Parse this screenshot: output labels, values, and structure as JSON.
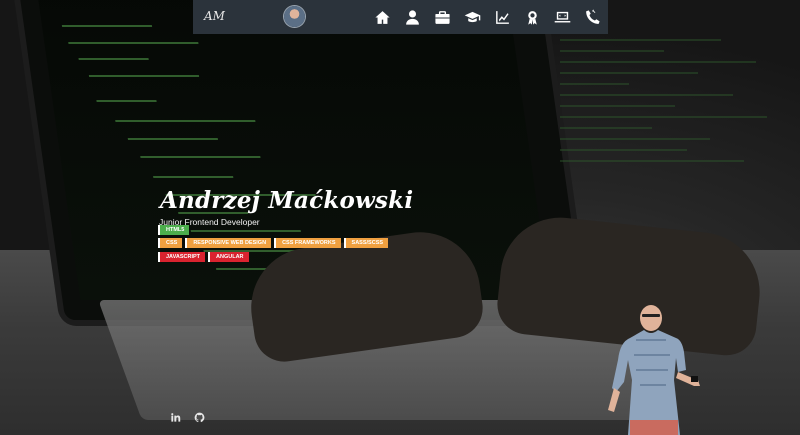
{
  "nav": {
    "logo": "AM",
    "icons": [
      "home-icon",
      "user-icon",
      "briefcase-icon",
      "graduation-cap-icon",
      "chart-line-icon",
      "certificate-icon",
      "laptop-code-icon",
      "phone-icon"
    ]
  },
  "hero": {
    "name": "Andrzej Maćkowski",
    "role": "Junior Frontend Developer"
  },
  "skills": {
    "row1": [
      {
        "label": "HTML5",
        "color": "#4cae4c"
      }
    ],
    "row2": [
      {
        "label": "CSS",
        "color": "#f0a040"
      },
      {
        "label": "Responsive Web Design",
        "color": "#f0a040"
      },
      {
        "label": "CSS Frameworks",
        "color": "#f0a040"
      },
      {
        "label": "SASS/SCSS",
        "color": "#f0a040"
      }
    ],
    "row3": [
      {
        "label": "JavaScript",
        "color": "#d9232f"
      },
      {
        "label": "Angular",
        "color": "#d9232f"
      }
    ]
  },
  "socials": [
    "linkedin-icon",
    "github-icon"
  ]
}
